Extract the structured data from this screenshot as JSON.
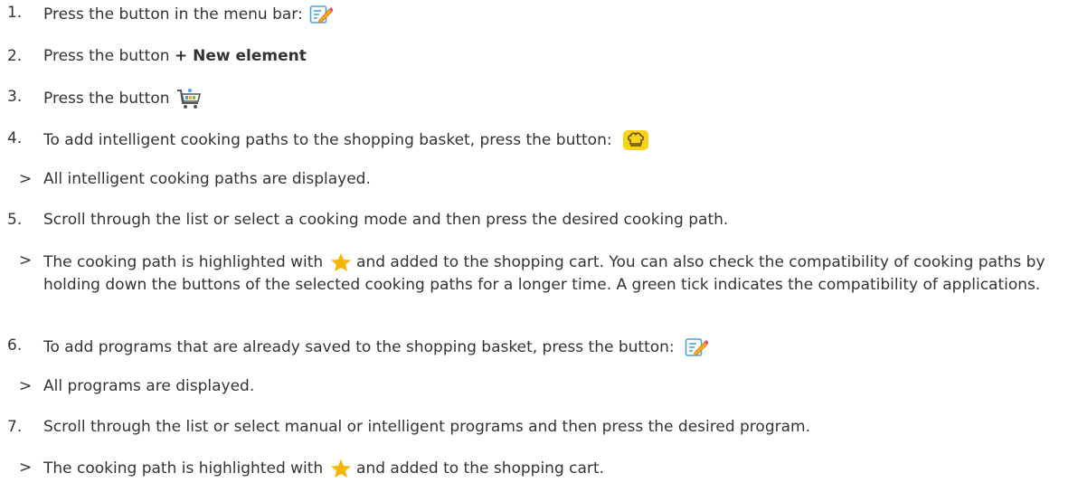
{
  "steps": [
    {
      "marker": "1.",
      "text": "Press the button in the menu bar:",
      "icon": "edit-icon"
    },
    {
      "marker": "2.",
      "text_before": "Press the button ",
      "text_bold": "+ New element"
    },
    {
      "marker": "3.",
      "text": "Press the button",
      "icon": "shopping-cart-icon"
    },
    {
      "marker": "4.",
      "text": "To add intelligent cooking paths to the shopping basket, press the button:",
      "icon": "chef-hat-icon"
    },
    {
      "marker": ">",
      "text": "All intelligent cooking paths are displayed."
    },
    {
      "marker": "5.",
      "text": "Scroll through the list or select a cooking mode and then press the desired cooking path."
    },
    {
      "marker": ">",
      "text_before": "The cooking path is highlighted with",
      "icon": "star-icon",
      "text_after": "and added to the shopping cart. You can also check the compatibility of cooking paths by holding down the buttons of the selected cooking paths for a longer time. A green tick indicates the compatibility of applications."
    },
    {
      "marker": "6.",
      "text": "To add programs that are already saved to the shopping basket, press the button:",
      "icon": "edit-icon"
    },
    {
      "marker": ">",
      "text": "All programs are displayed."
    },
    {
      "marker": "7.",
      "text": "Scroll through the list or select manual or intelligent programs and then press the desired program."
    },
    {
      "marker": ">",
      "text_before": "The cooking path is highlighted with",
      "icon": "star-icon",
      "text_after": "and added to the shopping cart."
    }
  ],
  "colors": {
    "text": "#333333",
    "edit_icon_blue": "#4aa3df",
    "edit_icon_pencil": "#f5a623",
    "chef_badge": "#f7d417",
    "star": "#f8b500"
  }
}
